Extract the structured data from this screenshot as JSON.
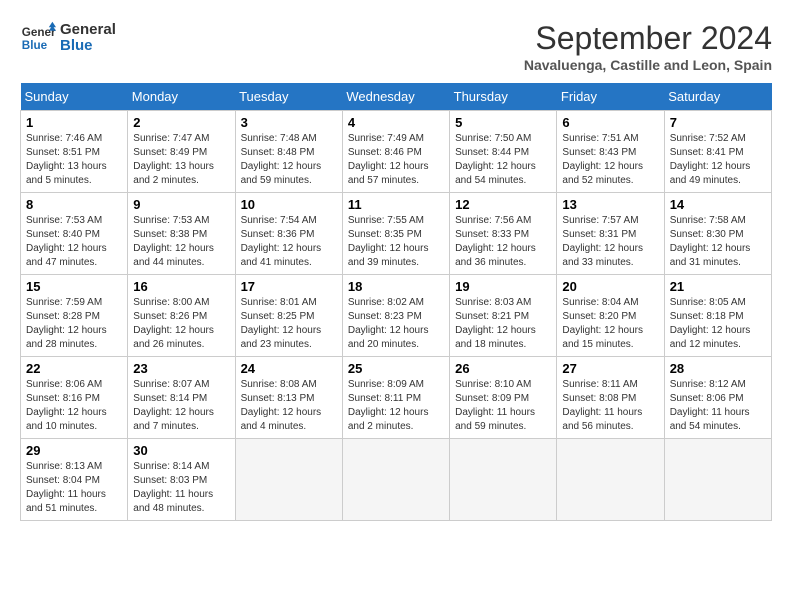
{
  "logo": {
    "line1": "General",
    "line2": "Blue"
  },
  "title": "September 2024",
  "subtitle": "Navaluenga, Castille and Leon, Spain",
  "days_header": [
    "Sunday",
    "Monday",
    "Tuesday",
    "Wednesday",
    "Thursday",
    "Friday",
    "Saturday"
  ],
  "weeks": [
    [
      {
        "num": "1",
        "sunrise": "7:46 AM",
        "sunset": "8:51 PM",
        "daylight": "13 hours and 5 minutes."
      },
      {
        "num": "2",
        "sunrise": "7:47 AM",
        "sunset": "8:49 PM",
        "daylight": "13 hours and 2 minutes."
      },
      {
        "num": "3",
        "sunrise": "7:48 AM",
        "sunset": "8:48 PM",
        "daylight": "12 hours and 59 minutes."
      },
      {
        "num": "4",
        "sunrise": "7:49 AM",
        "sunset": "8:46 PM",
        "daylight": "12 hours and 57 minutes."
      },
      {
        "num": "5",
        "sunrise": "7:50 AM",
        "sunset": "8:44 PM",
        "daylight": "12 hours and 54 minutes."
      },
      {
        "num": "6",
        "sunrise": "7:51 AM",
        "sunset": "8:43 PM",
        "daylight": "12 hours and 52 minutes."
      },
      {
        "num": "7",
        "sunrise": "7:52 AM",
        "sunset": "8:41 PM",
        "daylight": "12 hours and 49 minutes."
      }
    ],
    [
      {
        "num": "8",
        "sunrise": "7:53 AM",
        "sunset": "8:40 PM",
        "daylight": "12 hours and 47 minutes."
      },
      {
        "num": "9",
        "sunrise": "7:53 AM",
        "sunset": "8:38 PM",
        "daylight": "12 hours and 44 minutes."
      },
      {
        "num": "10",
        "sunrise": "7:54 AM",
        "sunset": "8:36 PM",
        "daylight": "12 hours and 41 minutes."
      },
      {
        "num": "11",
        "sunrise": "7:55 AM",
        "sunset": "8:35 PM",
        "daylight": "12 hours and 39 minutes."
      },
      {
        "num": "12",
        "sunrise": "7:56 AM",
        "sunset": "8:33 PM",
        "daylight": "12 hours and 36 minutes."
      },
      {
        "num": "13",
        "sunrise": "7:57 AM",
        "sunset": "8:31 PM",
        "daylight": "12 hours and 33 minutes."
      },
      {
        "num": "14",
        "sunrise": "7:58 AM",
        "sunset": "8:30 PM",
        "daylight": "12 hours and 31 minutes."
      }
    ],
    [
      {
        "num": "15",
        "sunrise": "7:59 AM",
        "sunset": "8:28 PM",
        "daylight": "12 hours and 28 minutes."
      },
      {
        "num": "16",
        "sunrise": "8:00 AM",
        "sunset": "8:26 PM",
        "daylight": "12 hours and 26 minutes."
      },
      {
        "num": "17",
        "sunrise": "8:01 AM",
        "sunset": "8:25 PM",
        "daylight": "12 hours and 23 minutes."
      },
      {
        "num": "18",
        "sunrise": "8:02 AM",
        "sunset": "8:23 PM",
        "daylight": "12 hours and 20 minutes."
      },
      {
        "num": "19",
        "sunrise": "8:03 AM",
        "sunset": "8:21 PM",
        "daylight": "12 hours and 18 minutes."
      },
      {
        "num": "20",
        "sunrise": "8:04 AM",
        "sunset": "8:20 PM",
        "daylight": "12 hours and 15 minutes."
      },
      {
        "num": "21",
        "sunrise": "8:05 AM",
        "sunset": "8:18 PM",
        "daylight": "12 hours and 12 minutes."
      }
    ],
    [
      {
        "num": "22",
        "sunrise": "8:06 AM",
        "sunset": "8:16 PM",
        "daylight": "12 hours and 10 minutes."
      },
      {
        "num": "23",
        "sunrise": "8:07 AM",
        "sunset": "8:14 PM",
        "daylight": "12 hours and 7 minutes."
      },
      {
        "num": "24",
        "sunrise": "8:08 AM",
        "sunset": "8:13 PM",
        "daylight": "12 hours and 4 minutes."
      },
      {
        "num": "25",
        "sunrise": "8:09 AM",
        "sunset": "8:11 PM",
        "daylight": "12 hours and 2 minutes."
      },
      {
        "num": "26",
        "sunrise": "8:10 AM",
        "sunset": "8:09 PM",
        "daylight": "11 hours and 59 minutes."
      },
      {
        "num": "27",
        "sunrise": "8:11 AM",
        "sunset": "8:08 PM",
        "daylight": "11 hours and 56 minutes."
      },
      {
        "num": "28",
        "sunrise": "8:12 AM",
        "sunset": "8:06 PM",
        "daylight": "11 hours and 54 minutes."
      }
    ],
    [
      {
        "num": "29",
        "sunrise": "8:13 AM",
        "sunset": "8:04 PM",
        "daylight": "11 hours and 51 minutes."
      },
      {
        "num": "30",
        "sunrise": "8:14 AM",
        "sunset": "8:03 PM",
        "daylight": "11 hours and 48 minutes."
      },
      null,
      null,
      null,
      null,
      null
    ]
  ]
}
